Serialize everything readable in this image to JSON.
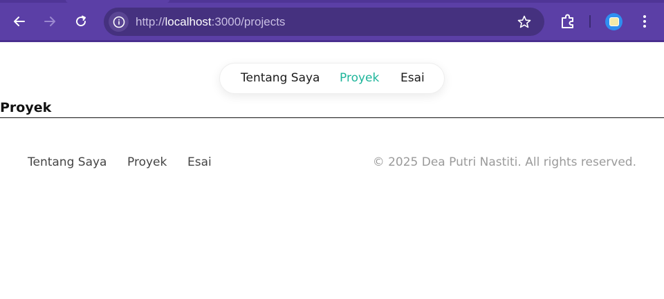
{
  "browser": {
    "url_prefix": "http://",
    "url_host": "localhost",
    "url_rest": ":3000/projects",
    "icons": [
      "back-arrow-icon",
      "forward-arrow-icon",
      "reload-icon",
      "info-icon",
      "star-icon",
      "extensions-icon",
      "profile-icon",
      "kebab-menu-icon"
    ],
    "accent_color": "#5b3fa6"
  },
  "nav": {
    "items": [
      {
        "label": "Tentang Saya"
      },
      {
        "label": "Proyek"
      },
      {
        "label": "Esai"
      }
    ],
    "active_color": "#1db59a"
  },
  "page": {
    "heading": "Proyek"
  },
  "footer": {
    "links": [
      {
        "label": "Tentang Saya"
      },
      {
        "label": "Proyek"
      },
      {
        "label": "Esai"
      }
    ],
    "copyright": "© 2025 Dea Putri Nastiti. All rights reserved."
  }
}
